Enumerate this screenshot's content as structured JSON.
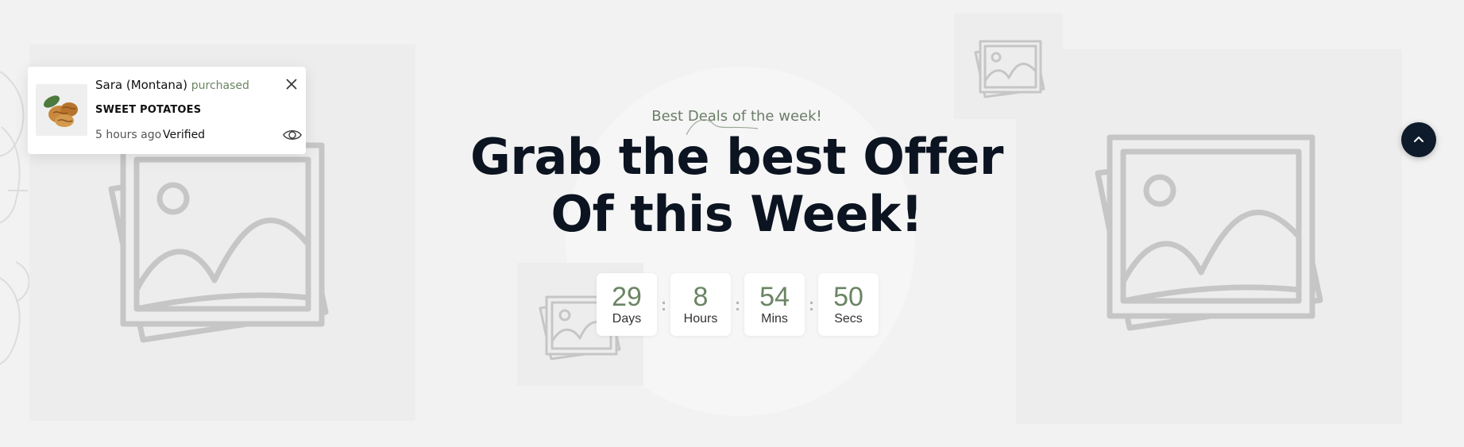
{
  "section": {
    "subtitle": "Best Deals of the week!",
    "headline": "Grab the best Offer Of this Week!"
  },
  "countdown": [
    {
      "value": "29",
      "label": "Days"
    },
    {
      "value": "8",
      "label": "Hours"
    },
    {
      "value": "54",
      "label": "Mins"
    },
    {
      "value": "50",
      "label": "Secs"
    }
  ],
  "separator": ":",
  "popup": {
    "buyer": "Sara (Montana)",
    "verb": "purchased",
    "product": "SWEET POTATOES",
    "time_ago": "5 hours ago",
    "status": "Verified"
  },
  "icons": {
    "close": "close-icon",
    "view": "eye-icon",
    "scroll_top": "chevron-up-icon",
    "placeholder": "image-placeholder-icon"
  },
  "colors": {
    "background": "#f2f2f2",
    "accent_green": "#6b8564",
    "headline": "#0b1420",
    "scroll_button": "#0d1b2a"
  }
}
